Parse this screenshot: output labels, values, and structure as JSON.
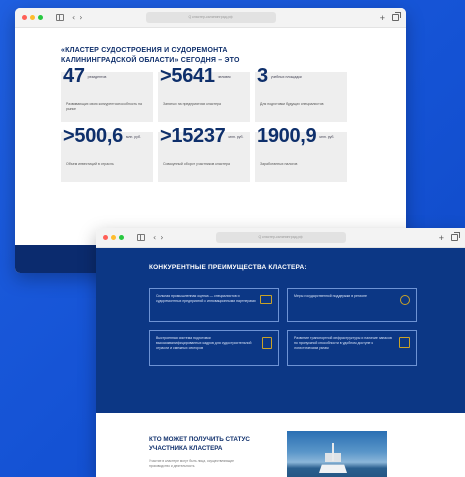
{
  "window_a": {
    "url_text": "Q  кластер-калининград.рф",
    "title": "«КЛАСТЕР СУДОСТРОЕНИЯ И СУДОРЕМОНТА КАЛИНИНГРАДСКОЙ ОБЛАСТИ» СЕГОДНЯ – ЭТО",
    "stats": [
      {
        "value": "47",
        "unit": "резидентов",
        "desc": "Развивающих свою конкурентоспособность на рынке"
      },
      {
        "value": ">5641",
        "unit": "человек",
        "desc": "Занятых на предприятиях кластера"
      },
      {
        "value": "3",
        "unit": "учебных площадки",
        "desc": "Для подготовки будущих специалистов"
      },
      {
        "value": ">500,6",
        "unit": "млн. руб.",
        "desc": "Объем инвестиций в отрасль"
      },
      {
        "value": ">15237",
        "unit": "млн. руб.",
        "desc": "Совокупный оборот участников кластера"
      },
      {
        "value": "1900,9",
        "unit": "млн. руб.",
        "desc": "Заработанных налогов"
      }
    ]
  },
  "window_b": {
    "url_text": "Q  кластер-калининград.рф",
    "title": "КОНКУРЕНТНЫЕ ПРЕИМУЩЕСТВА КЛАСТЕРА:",
    "advantages": [
      {
        "text": "Сильная промышленная оценка — специалистов и судоремонтных предприятий с инновационными партнерами",
        "icon": "ship-icon"
      },
      {
        "text": "Меры государственной поддержки в регионе",
        "icon": "handshake-icon"
      },
      {
        "text": "Выстроенная система подготовки высококвалифицированных кадров для судостроительной отрасли и смежных секторов",
        "icon": "certificate-icon"
      },
      {
        "text": "Развитие транспортной инфраструктуры и наличие запасов по пропускной способности в удобном доступе к логистическим узлам",
        "icon": "map-icon"
      }
    ],
    "who_title": "КТО МОЖЕТ ПОЛУЧИТЬ СТАТУС УЧАСТНИКА КЛАСТЕРА",
    "who_sub": "Участие в кластере могут быть лица, осуществляющие производство и деятельность"
  }
}
